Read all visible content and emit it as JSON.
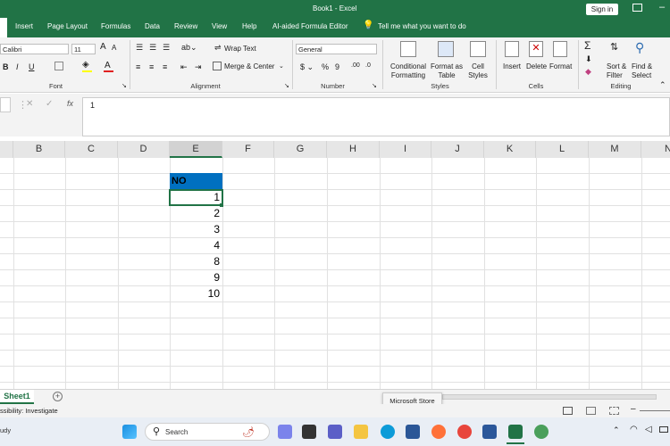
{
  "title": {
    "doc": "Book1 - Excel",
    "signin": "Sign in"
  },
  "tabs": [
    "Insert",
    "Page Layout",
    "Formulas",
    "Data",
    "Review",
    "View",
    "Help",
    "AI-aided Formula Editor"
  ],
  "tell_me": "Tell me what you want to do",
  "ribbon": {
    "font_name": "Calibri",
    "font_size": "11",
    "wrap_text": "Wrap Text",
    "merge_center": "Merge & Center",
    "number_format": "General",
    "cond_format": [
      "Conditional",
      "Formatting"
    ],
    "format_table": [
      "Format as",
      "Table"
    ],
    "cell_styles": [
      "Cell",
      "Styles"
    ],
    "insert": "Insert",
    "delete": "Delete",
    "format": "Format",
    "sort_filter": [
      "Sort &",
      "Filter"
    ],
    "find_select": [
      "Find &",
      "Select"
    ],
    "groups": [
      "Font",
      "Alignment",
      "Number",
      "Styles",
      "Cells",
      "Editing"
    ]
  },
  "formula": {
    "value": "1",
    "fx": "fx"
  },
  "columns": [
    "B",
    "C",
    "D",
    "E",
    "F",
    "G",
    "H",
    "I",
    "J",
    "K",
    "L",
    "M",
    "N"
  ],
  "cells": {
    "header": "NO",
    "values": [
      "1",
      "2",
      "3",
      "4",
      "8",
      "9",
      "10"
    ]
  },
  "sheet": {
    "tab": "Sheet1",
    "add": "+"
  },
  "status": {
    "accessibility": "ssibility: Investigate",
    "left": "udy"
  },
  "tooltip": "Microsoft Store",
  "taskbar": {
    "search": "Search"
  }
}
